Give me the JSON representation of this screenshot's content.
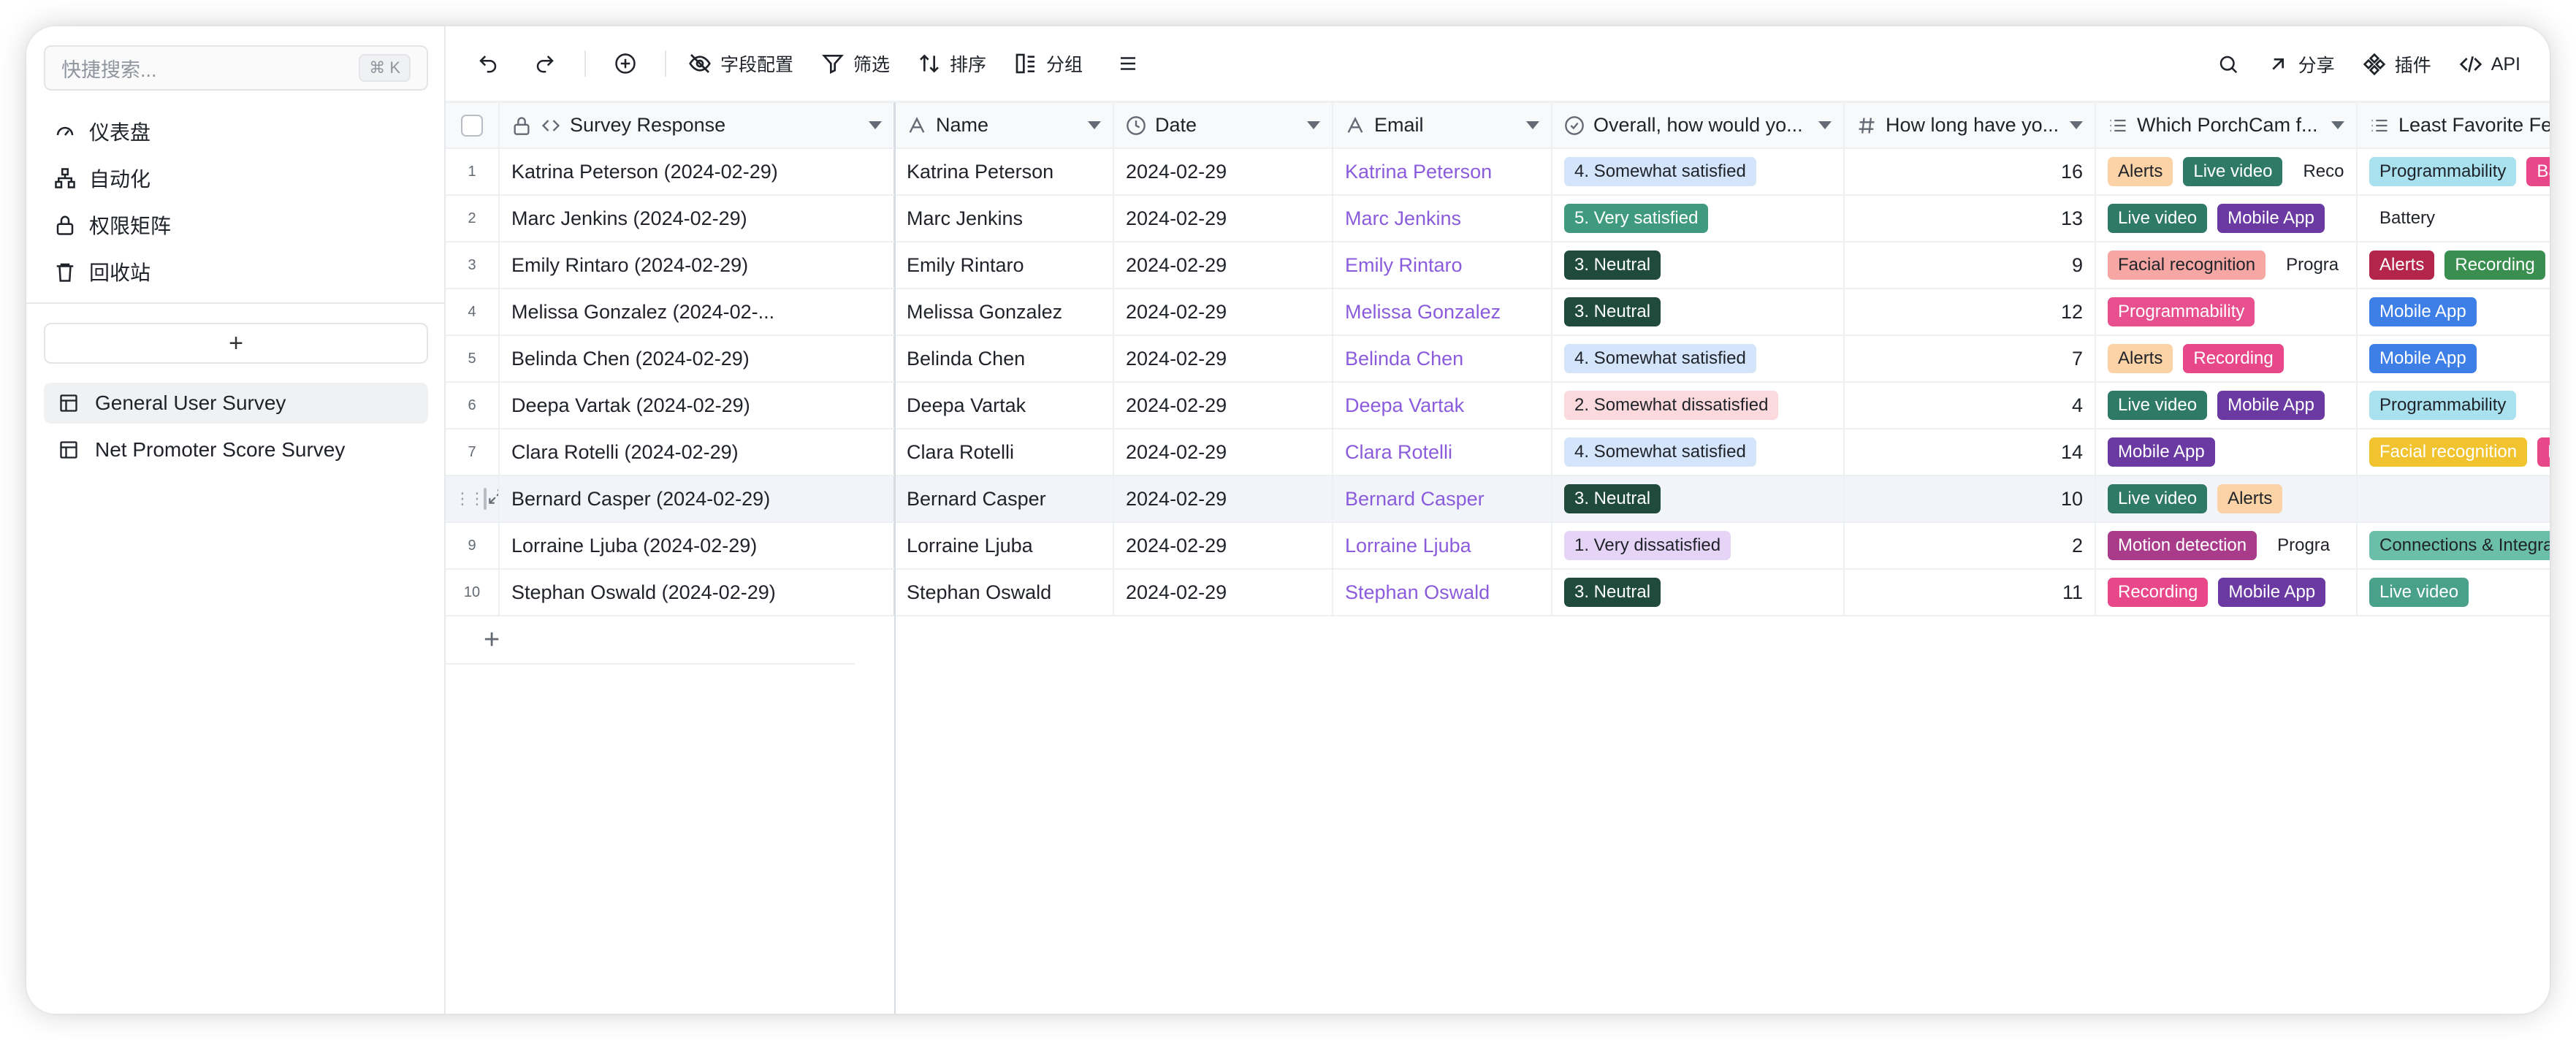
{
  "sidebar": {
    "search_placeholder": "快捷搜索...",
    "search_shortcut": "⌘ K",
    "nav": [
      {
        "label": "仪表盘",
        "icon": "dashboard-icon"
      },
      {
        "label": "自动化",
        "icon": "automation-icon"
      },
      {
        "label": "权限矩阵",
        "icon": "lock-icon"
      },
      {
        "label": "回收站",
        "icon": "trash-icon"
      }
    ],
    "add_label": "+",
    "tables": [
      {
        "label": "General User Survey",
        "icon": "table-icon",
        "active": true
      },
      {
        "label": "Net Promoter Score Survey",
        "icon": "table-icon",
        "active": false
      }
    ]
  },
  "toolbar": {
    "fields_label": "字段配置",
    "filter_label": "筛选",
    "sort_label": "排序",
    "group_label": "分组",
    "share_label": "分享",
    "plugins_label": "插件",
    "api_label": "API"
  },
  "columns": [
    {
      "key": "response",
      "label": "Survey Response"
    },
    {
      "key": "name",
      "label": "Name"
    },
    {
      "key": "date",
      "label": "Date"
    },
    {
      "key": "email",
      "label": "Email"
    },
    {
      "key": "overall",
      "label": "Overall, how would yo..."
    },
    {
      "key": "howlong",
      "label": "How long have yo..."
    },
    {
      "key": "which",
      "label": "Which PorchCam f..."
    },
    {
      "key": "least",
      "label": "Least Favorite Featu"
    }
  ],
  "colors": {
    "Alerts": [
      "#fbd3a6",
      "#1f2329"
    ],
    "Live video": [
      "#2f7a66",
      "#ffffff"
    ],
    "Recording": [
      "#e8478a",
      "#ffffff"
    ],
    "Mobile App": [
      "#6a3aa2",
      "#ffffff"
    ],
    "Facial recognition": [
      "#f6a7a3",
      "#1f2329"
    ],
    "Programmability": [
      "#e84f8f",
      "#ffffff"
    ],
    "Motion detection": [
      "#a83c8a",
      "#ffffff"
    ],
    "Battery": [
      "#e8478a",
      "#ffffff"
    ],
    "L_Programmability": [
      "#a9e2ee",
      "#1f2329"
    ],
    "L_Alerts": [
      "#b3254a",
      "#ffffff"
    ],
    "L_Recording": [
      "#3a8f50",
      "#ffffff"
    ],
    "L_Mobile App": [
      "#3d7fe6",
      "#ffffff"
    ],
    "L_Facial recognition": [
      "#f1c32e",
      "#ffffff"
    ],
    "L_Live video": [
      "#49a08b",
      "#ffffff"
    ],
    "L_Connections & Integrati": [
      "#6bbfaa",
      "#1f2329"
    ],
    "L_M": [
      "#e8478a",
      "#ffffff"
    ],
    "L_Batt": [
      "#e8478a",
      "#ffffff"
    ],
    "1. Very dissatisfied": [
      "#e6d4f7",
      "#1f2329"
    ],
    "2. Somewhat dissatisfied": [
      "#fbd9dc",
      "#1f2329"
    ],
    "3. Neutral": [
      "#1f4a3c",
      "#ffffff"
    ],
    "4. Somewhat satisfied": [
      "#d3e4fb",
      "#1f2329"
    ],
    "5. Very satisfied": [
      "#3f9a7e",
      "#ffffff"
    ]
  },
  "rows": [
    {
      "idx": "1",
      "response": "Katrina Peterson (2024-02-29)",
      "name": "Katrina Peterson",
      "date": "2024-02-29",
      "email": "Katrina Peterson",
      "overall": "4. Somewhat satisfied",
      "howlong": "16",
      "which": [
        "Alerts",
        "Live video",
        "Reco"
      ],
      "least": [
        "Programmability",
        "Batt"
      ]
    },
    {
      "idx": "2",
      "response": "Marc Jenkins (2024-02-29)",
      "name": "Marc Jenkins",
      "date": "2024-02-29",
      "email": "Marc Jenkins",
      "overall": "5. Very satisfied",
      "howlong": "13",
      "which": [
        "Live video",
        "Mobile App"
      ],
      "least": [
        "Battery"
      ]
    },
    {
      "idx": "3",
      "response": "Emily Rintaro (2024-02-29)",
      "name": "Emily Rintaro",
      "date": "2024-02-29",
      "email": "Emily Rintaro",
      "overall": "3. Neutral",
      "howlong": "9",
      "which": [
        "Facial recognition",
        "Progra"
      ],
      "least": [
        "Alerts",
        "Recording"
      ]
    },
    {
      "idx": "4",
      "response": "Melissa Gonzalez (2024-02-...",
      "name": "Melissa Gonzalez",
      "date": "2024-02-29",
      "email": "Melissa Gonzalez",
      "overall": "3. Neutral",
      "howlong": "12",
      "which": [
        "Programmability"
      ],
      "least": [
        "Mobile App"
      ]
    },
    {
      "idx": "5",
      "response": "Belinda Chen (2024-02-29)",
      "name": "Belinda Chen",
      "date": "2024-02-29",
      "email": "Belinda Chen",
      "overall": "4. Somewhat satisfied",
      "howlong": "7",
      "which": [
        "Alerts",
        "Recording"
      ],
      "least": [
        "Mobile App"
      ]
    },
    {
      "idx": "6",
      "response": "Deepa Vartak (2024-02-29)",
      "name": "Deepa Vartak",
      "date": "2024-02-29",
      "email": "Deepa Vartak",
      "overall": "2. Somewhat dissatisfied",
      "howlong": "4",
      "which": [
        "Live video",
        "Mobile App"
      ],
      "least": [
        "Programmability"
      ]
    },
    {
      "idx": "7",
      "response": "Clara Rotelli (2024-02-29)",
      "name": "Clara Rotelli",
      "date": "2024-02-29",
      "email": "Clara Rotelli",
      "overall": "4. Somewhat satisfied",
      "howlong": "14",
      "which": [
        "Mobile App"
      ],
      "least": [
        "Facial recognition",
        "M"
      ]
    },
    {
      "idx": "8",
      "response": "Bernard Casper (2024-02-29)",
      "name": "Bernard Casper",
      "date": "2024-02-29",
      "email": "Bernard Casper",
      "overall": "3. Neutral",
      "howlong": "10",
      "which": [
        "Live video",
        "Alerts"
      ],
      "least": [],
      "hover": true
    },
    {
      "idx": "9",
      "response": "Lorraine Ljuba (2024-02-29)",
      "name": "Lorraine Ljuba",
      "date": "2024-02-29",
      "email": "Lorraine Ljuba",
      "overall": "1. Very dissatisfied",
      "howlong": "2",
      "which": [
        "Motion detection",
        "Progra"
      ],
      "least": [
        "Connections & Integrati"
      ]
    },
    {
      "idx": "10",
      "response": "Stephan Oswald (2024-02-29)",
      "name": "Stephan Oswald",
      "date": "2024-02-29",
      "email": "Stephan Oswald",
      "overall": "3. Neutral",
      "howlong": "11",
      "which": [
        "Recording",
        "Mobile App"
      ],
      "least": [
        "Live video"
      ]
    }
  ]
}
